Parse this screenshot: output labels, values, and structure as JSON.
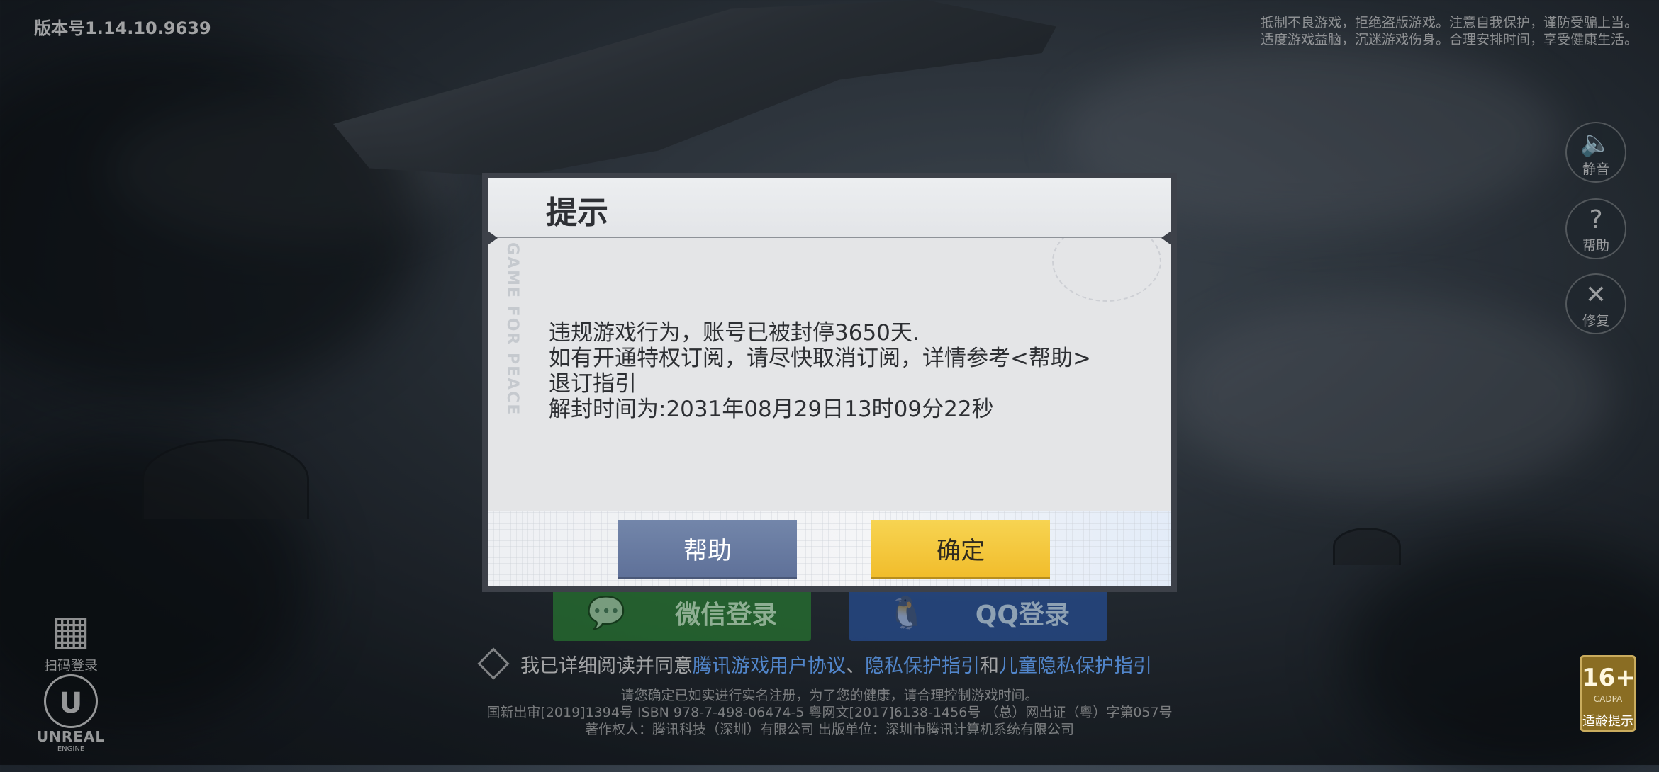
{
  "version": "版本号1.14.10.9639",
  "top_notice": [
    "抵制不良游戏，拒绝盗版游戏。注意自我保护，谨防受骗上当。",
    "适度游戏益脑，沉迷游戏伤身。合理安排时间，享受健康生活。"
  ],
  "side_buttons": [
    {
      "label": "静音",
      "icon": "speaker-icon"
    },
    {
      "label": "帮助",
      "icon": "question-icon"
    },
    {
      "label": "修复",
      "icon": "wrench-icon"
    }
  ],
  "dialog": {
    "title": "提示",
    "lines": [
      "违规游戏行为，账号已被封停3650天.",
      "如有开通特权订阅，请尽快取消订阅，详情参考<帮助>",
      "退订指引",
      "解封时间为:2031年08月29日13时09分22秒"
    ],
    "help_button": "帮助",
    "ok_button": "确定",
    "watermark": "GAME FOR PEACE"
  },
  "login": {
    "wechat": "微信登录",
    "qq": "QQ登录"
  },
  "agreement": {
    "prefix": "我已详细阅读并同意",
    "link1": "腾讯游戏用户协议",
    "sep": "、",
    "link2": "隐私保护指引",
    "and": "和",
    "link3": "儿童隐私保护指引"
  },
  "legal": [
    "请您确定已如实进行实名注册，为了您的健康，请合理控制游戏时间。",
    "国新出审[2019]1394号  ISBN 978-7-498-06474-5  粤网文[2017]6138-1456号 （总）网出证（粤）字第057号",
    "著作权人：腾讯科技（深圳）有限公司   出版单位：深圳市腾讯计算机系统有限公司"
  ],
  "qr_login": "扫码登录",
  "engine": "UNREAL",
  "engine_sub": "ENGINE",
  "age_rating": {
    "age": "16+",
    "org": "CADPA",
    "label": "适龄提示"
  }
}
